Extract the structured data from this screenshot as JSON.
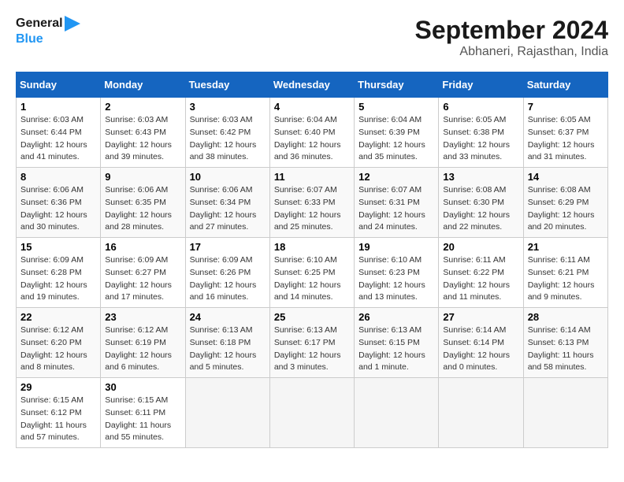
{
  "logo": {
    "line1": "General",
    "line2": "Blue"
  },
  "title": "September 2024",
  "location": "Abhaneri, Rajasthan, India",
  "days_of_week": [
    "Sunday",
    "Monday",
    "Tuesday",
    "Wednesday",
    "Thursday",
    "Friday",
    "Saturday"
  ],
  "weeks": [
    [
      {
        "day": "1",
        "sunrise": "Sunrise: 6:03 AM",
        "sunset": "Sunset: 6:44 PM",
        "daylight": "Daylight: 12 hours and 41 minutes."
      },
      {
        "day": "2",
        "sunrise": "Sunrise: 6:03 AM",
        "sunset": "Sunset: 6:43 PM",
        "daylight": "Daylight: 12 hours and 39 minutes."
      },
      {
        "day": "3",
        "sunrise": "Sunrise: 6:03 AM",
        "sunset": "Sunset: 6:42 PM",
        "daylight": "Daylight: 12 hours and 38 minutes."
      },
      {
        "day": "4",
        "sunrise": "Sunrise: 6:04 AM",
        "sunset": "Sunset: 6:40 PM",
        "daylight": "Daylight: 12 hours and 36 minutes."
      },
      {
        "day": "5",
        "sunrise": "Sunrise: 6:04 AM",
        "sunset": "Sunset: 6:39 PM",
        "daylight": "Daylight: 12 hours and 35 minutes."
      },
      {
        "day": "6",
        "sunrise": "Sunrise: 6:05 AM",
        "sunset": "Sunset: 6:38 PM",
        "daylight": "Daylight: 12 hours and 33 minutes."
      },
      {
        "day": "7",
        "sunrise": "Sunrise: 6:05 AM",
        "sunset": "Sunset: 6:37 PM",
        "daylight": "Daylight: 12 hours and 31 minutes."
      }
    ],
    [
      {
        "day": "8",
        "sunrise": "Sunrise: 6:06 AM",
        "sunset": "Sunset: 6:36 PM",
        "daylight": "Daylight: 12 hours and 30 minutes."
      },
      {
        "day": "9",
        "sunrise": "Sunrise: 6:06 AM",
        "sunset": "Sunset: 6:35 PM",
        "daylight": "Daylight: 12 hours and 28 minutes."
      },
      {
        "day": "10",
        "sunrise": "Sunrise: 6:06 AM",
        "sunset": "Sunset: 6:34 PM",
        "daylight": "Daylight: 12 hours and 27 minutes."
      },
      {
        "day": "11",
        "sunrise": "Sunrise: 6:07 AM",
        "sunset": "Sunset: 6:33 PM",
        "daylight": "Daylight: 12 hours and 25 minutes."
      },
      {
        "day": "12",
        "sunrise": "Sunrise: 6:07 AM",
        "sunset": "Sunset: 6:31 PM",
        "daylight": "Daylight: 12 hours and 24 minutes."
      },
      {
        "day": "13",
        "sunrise": "Sunrise: 6:08 AM",
        "sunset": "Sunset: 6:30 PM",
        "daylight": "Daylight: 12 hours and 22 minutes."
      },
      {
        "day": "14",
        "sunrise": "Sunrise: 6:08 AM",
        "sunset": "Sunset: 6:29 PM",
        "daylight": "Daylight: 12 hours and 20 minutes."
      }
    ],
    [
      {
        "day": "15",
        "sunrise": "Sunrise: 6:09 AM",
        "sunset": "Sunset: 6:28 PM",
        "daylight": "Daylight: 12 hours and 19 minutes."
      },
      {
        "day": "16",
        "sunrise": "Sunrise: 6:09 AM",
        "sunset": "Sunset: 6:27 PM",
        "daylight": "Daylight: 12 hours and 17 minutes."
      },
      {
        "day": "17",
        "sunrise": "Sunrise: 6:09 AM",
        "sunset": "Sunset: 6:26 PM",
        "daylight": "Daylight: 12 hours and 16 minutes."
      },
      {
        "day": "18",
        "sunrise": "Sunrise: 6:10 AM",
        "sunset": "Sunset: 6:25 PM",
        "daylight": "Daylight: 12 hours and 14 minutes."
      },
      {
        "day": "19",
        "sunrise": "Sunrise: 6:10 AM",
        "sunset": "Sunset: 6:23 PM",
        "daylight": "Daylight: 12 hours and 13 minutes."
      },
      {
        "day": "20",
        "sunrise": "Sunrise: 6:11 AM",
        "sunset": "Sunset: 6:22 PM",
        "daylight": "Daylight: 12 hours and 11 minutes."
      },
      {
        "day": "21",
        "sunrise": "Sunrise: 6:11 AM",
        "sunset": "Sunset: 6:21 PM",
        "daylight": "Daylight: 12 hours and 9 minutes."
      }
    ],
    [
      {
        "day": "22",
        "sunrise": "Sunrise: 6:12 AM",
        "sunset": "Sunset: 6:20 PM",
        "daylight": "Daylight: 12 hours and 8 minutes."
      },
      {
        "day": "23",
        "sunrise": "Sunrise: 6:12 AM",
        "sunset": "Sunset: 6:19 PM",
        "daylight": "Daylight: 12 hours and 6 minutes."
      },
      {
        "day": "24",
        "sunrise": "Sunrise: 6:13 AM",
        "sunset": "Sunset: 6:18 PM",
        "daylight": "Daylight: 12 hours and 5 minutes."
      },
      {
        "day": "25",
        "sunrise": "Sunrise: 6:13 AM",
        "sunset": "Sunset: 6:17 PM",
        "daylight": "Daylight: 12 hours and 3 minutes."
      },
      {
        "day": "26",
        "sunrise": "Sunrise: 6:13 AM",
        "sunset": "Sunset: 6:15 PM",
        "daylight": "Daylight: 12 hours and 1 minute."
      },
      {
        "day": "27",
        "sunrise": "Sunrise: 6:14 AM",
        "sunset": "Sunset: 6:14 PM",
        "daylight": "Daylight: 12 hours and 0 minutes."
      },
      {
        "day": "28",
        "sunrise": "Sunrise: 6:14 AM",
        "sunset": "Sunset: 6:13 PM",
        "daylight": "Daylight: 11 hours and 58 minutes."
      }
    ],
    [
      {
        "day": "29",
        "sunrise": "Sunrise: 6:15 AM",
        "sunset": "Sunset: 6:12 PM",
        "daylight": "Daylight: 11 hours and 57 minutes."
      },
      {
        "day": "30",
        "sunrise": "Sunrise: 6:15 AM",
        "sunset": "Sunset: 6:11 PM",
        "daylight": "Daylight: 11 hours and 55 minutes."
      },
      null,
      null,
      null,
      null,
      null
    ]
  ]
}
